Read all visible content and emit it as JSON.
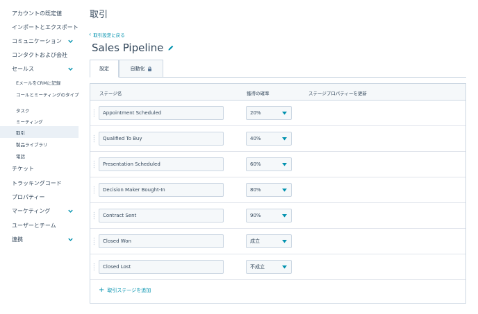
{
  "sidebar": {
    "items": [
      {
        "label": "アカウントの既定値",
        "chevron": false
      },
      {
        "label": "インポートとエクスポート",
        "chevron": false
      },
      {
        "label": "コミュニケーション",
        "chevron": true
      },
      {
        "label": "コンタクトおよび会社",
        "chevron": false
      },
      {
        "label": "セールス",
        "chevron": true
      },
      {
        "label": "EメールをCRMに記録",
        "sub": true
      },
      {
        "label": "コールとミーティングのタイプ",
        "sub": true
      },
      {
        "label": "タスク",
        "sub": true
      },
      {
        "label": "ミーティング",
        "sub": true
      },
      {
        "label": "取引",
        "sub": true,
        "active": true
      },
      {
        "label": "製品ライブラリ",
        "sub": true
      },
      {
        "label": "電話",
        "sub": true
      },
      {
        "label": "チケット",
        "chevron": false
      },
      {
        "label": "トラッキングコード",
        "chevron": false
      },
      {
        "label": "プロパティー",
        "chevron": false
      },
      {
        "label": "マーケティング",
        "chevron": true
      },
      {
        "label": "ユーザーとチーム",
        "chevron": false
      },
      {
        "label": "連携",
        "chevron": true
      }
    ]
  },
  "main": {
    "page_title": "取引",
    "back_link": "取引設定に戻る",
    "pipeline_name": "Sales Pipeline",
    "tabs": [
      {
        "label": "設定",
        "active": true
      },
      {
        "label": "自動化",
        "active": false,
        "icon": "lock-icon"
      }
    ],
    "table": {
      "headers": {
        "stage_name": "ステージ名",
        "probability": "獲得の確率",
        "property_update": "ステージプロパティーを更新"
      },
      "rows": [
        {
          "stage": "Appointment Scheduled",
          "probability": "20%"
        },
        {
          "stage": "Qualified To Buy",
          "probability": "40%"
        },
        {
          "stage": "Presentation Scheduled",
          "probability": "60%"
        },
        {
          "stage": "Decision Maker Bought-In",
          "probability": "80%"
        },
        {
          "stage": "Contract Sent",
          "probability": "90%"
        },
        {
          "stage": "Closed Won",
          "probability": "成立"
        },
        {
          "stage": "Closed Lost",
          "probability": "不成立"
        }
      ]
    },
    "add_stage_label": "取引ステージを追加"
  },
  "colors": {
    "accent": "#0091ae",
    "text": "#33475b",
    "border": "#cbd6e2",
    "input_bg": "#f5f8fa",
    "active_nav_bg": "#eaf0f6"
  }
}
